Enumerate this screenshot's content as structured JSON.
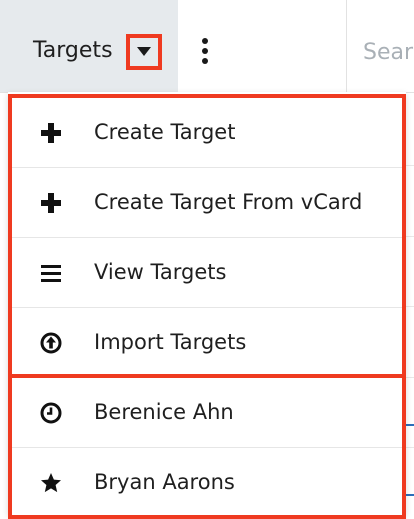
{
  "header": {
    "module_tab_label": "Targets",
    "search_placeholder": "Sear"
  },
  "menu": {
    "actions": [
      {
        "label": "Create Target",
        "icon": "plus-icon"
      },
      {
        "label": "Create Target From vCard",
        "icon": "plus-icon"
      },
      {
        "label": "View Targets",
        "icon": "list-icon"
      },
      {
        "label": "Import Targets",
        "icon": "upload-circle-icon"
      }
    ],
    "recent": [
      {
        "label": "Berenice Ahn",
        "icon": "clock-icon"
      },
      {
        "label": "Bryan Aarons",
        "icon": "star-icon"
      }
    ]
  },
  "colors": {
    "highlight": "#ef3a20",
    "tab_background": "#e6eaed",
    "link": "#2a6ebb"
  }
}
